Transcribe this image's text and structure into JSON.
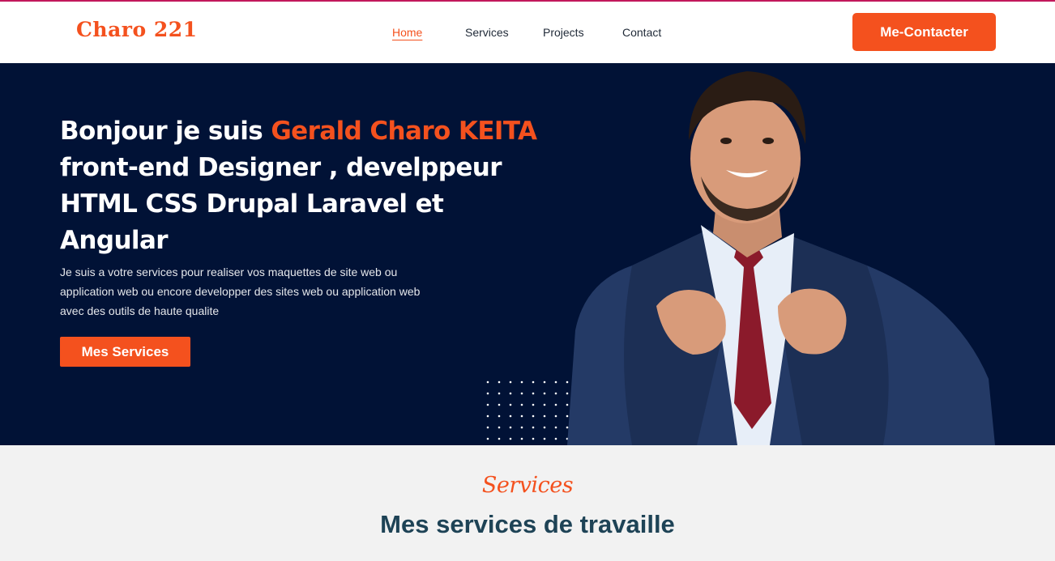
{
  "header": {
    "logo": "Charo 221",
    "nav": [
      {
        "label": "Home",
        "active": true
      },
      {
        "label": "Services",
        "active": false
      },
      {
        "label": "Projects",
        "active": false
      },
      {
        "label": "Contact",
        "active": false
      }
    ],
    "contact_button": "Me-Contacter"
  },
  "hero": {
    "title_prefix": "Bonjour je suis ",
    "title_name": "Gerald Charo KEITA",
    "title_rest": "front-end Designer , develppeur HTML CSS Drupal Laravel et Angular",
    "description": "Je suis a votre services pour realiser vos maquettes de site web ou application web ou encore developper des sites web ou application web avec des outils de haute qualite",
    "cta_button": "Mes Services"
  },
  "services": {
    "script_label": "Services",
    "heading": "Mes services de travaille"
  },
  "colors": {
    "accent": "#f4511e",
    "hero_bg": "#011236",
    "heading": "#1e4356"
  }
}
